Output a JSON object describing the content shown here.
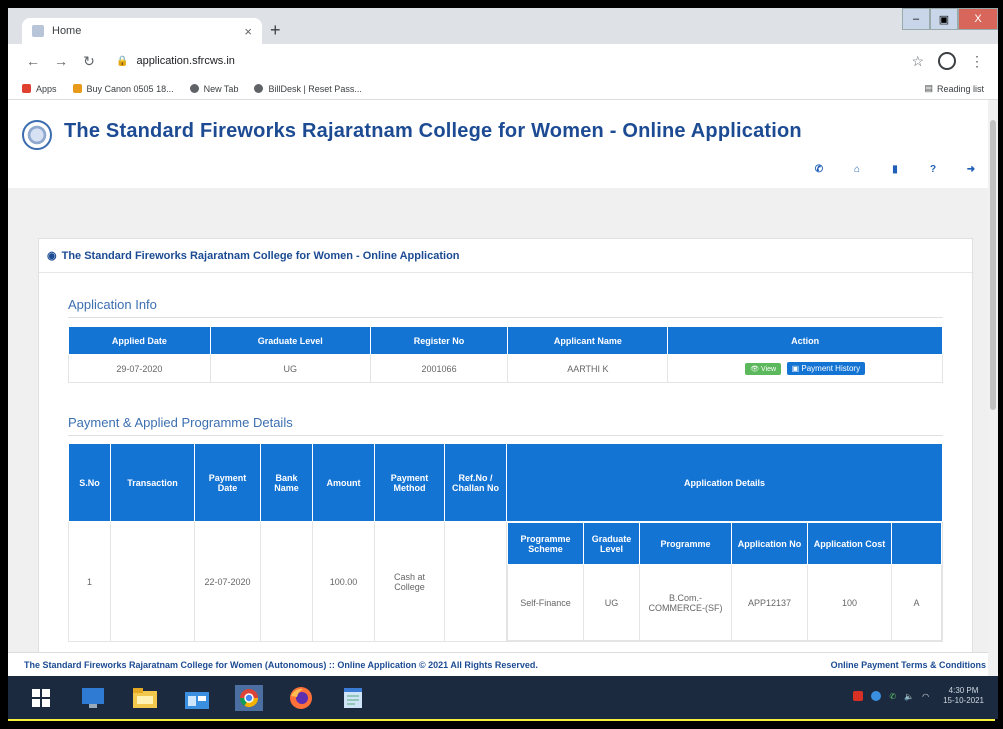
{
  "browser": {
    "tab_title": "Home",
    "tab_close": "×",
    "new_tab": "+",
    "url": "application.sfrcws.in",
    "window_controls": {
      "minimize": "–",
      "maximize": "▣",
      "close": "X"
    },
    "bookmarks": [
      {
        "label": "Apps",
        "icon": "apps-grid-icon",
        "color": "#e0402f"
      },
      {
        "label": "Buy Canon 0505 18...",
        "icon": "amazon-icon",
        "color": "#e89a1b"
      },
      {
        "label": "New Tab",
        "icon": "globe-icon",
        "color": "#5f6368"
      },
      {
        "label": "BillDesk | Reset Pass...",
        "icon": "globe-icon",
        "color": "#5f6368"
      }
    ],
    "reading_list": "Reading list"
  },
  "site": {
    "title": "The Standard Fireworks Rajaratnam College for Women - Online Application",
    "header_icons": [
      "phone-icon",
      "home-icon",
      "bookmark-icon",
      "help-icon",
      "logout-icon"
    ],
    "header_glyphs": [
      "✆",
      "⌂",
      "▮",
      "?",
      "➜"
    ]
  },
  "panel": {
    "heading": "The Standard Fireworks Rajaratnam College for Women - Online Application",
    "app_info_title": "Application Info",
    "app_info_table": {
      "headers": [
        "Applied Date",
        "Graduate Level",
        "Register No",
        "Applicant Name",
        "Action"
      ],
      "row": {
        "applied_date": "29-07-2020",
        "graduate_level": "UG",
        "register_no": "2001066",
        "applicant_name": "AARTHI K"
      },
      "view_label": "View",
      "payment_history_label": "Payment History"
    },
    "payment_title": "Payment & Applied Programme Details",
    "payment_table": {
      "headers": {
        "sno": "S.No",
        "transaction": "Transaction",
        "payment_date": "Payment Date",
        "bank_name": "Bank Name",
        "amount": "Amount",
        "payment_method": "Payment Method",
        "ref_no": "Ref.No / Challan No",
        "app_details": "Application Details"
      },
      "sub_headers": [
        "Programme Scheme",
        "Graduate Level",
        "Programme",
        "Application No",
        "Application Cost"
      ],
      "row": {
        "sno": "1",
        "transaction": "",
        "payment_date": "22-07-2020",
        "bank_name": "",
        "amount": "100.00",
        "payment_method": "Cash at College",
        "ref_no": "",
        "programme_scheme": "Self-Finance",
        "graduate_level": "UG",
        "programme": "B.Com.-COMMERCE-(SF)",
        "application_no": "APP12137",
        "application_cost": "100",
        "extra": "A"
      }
    }
  },
  "footer": {
    "copyright": "The Standard Fireworks Rajaratnam College for Women (Autonomous) :: Online Application © 2021 All Rights Reserved.",
    "terms_link": "Online Payment Terms & Conditions"
  },
  "taskbar": {
    "items": [
      "windows-start-icon",
      "remote-desktop-icon",
      "file-explorer-icon",
      "store-icon",
      "chrome-icon",
      "firefox-icon",
      "notepad-icon"
    ],
    "clock_time": "4:30 PM",
    "clock_date": "15-10-2021"
  }
}
